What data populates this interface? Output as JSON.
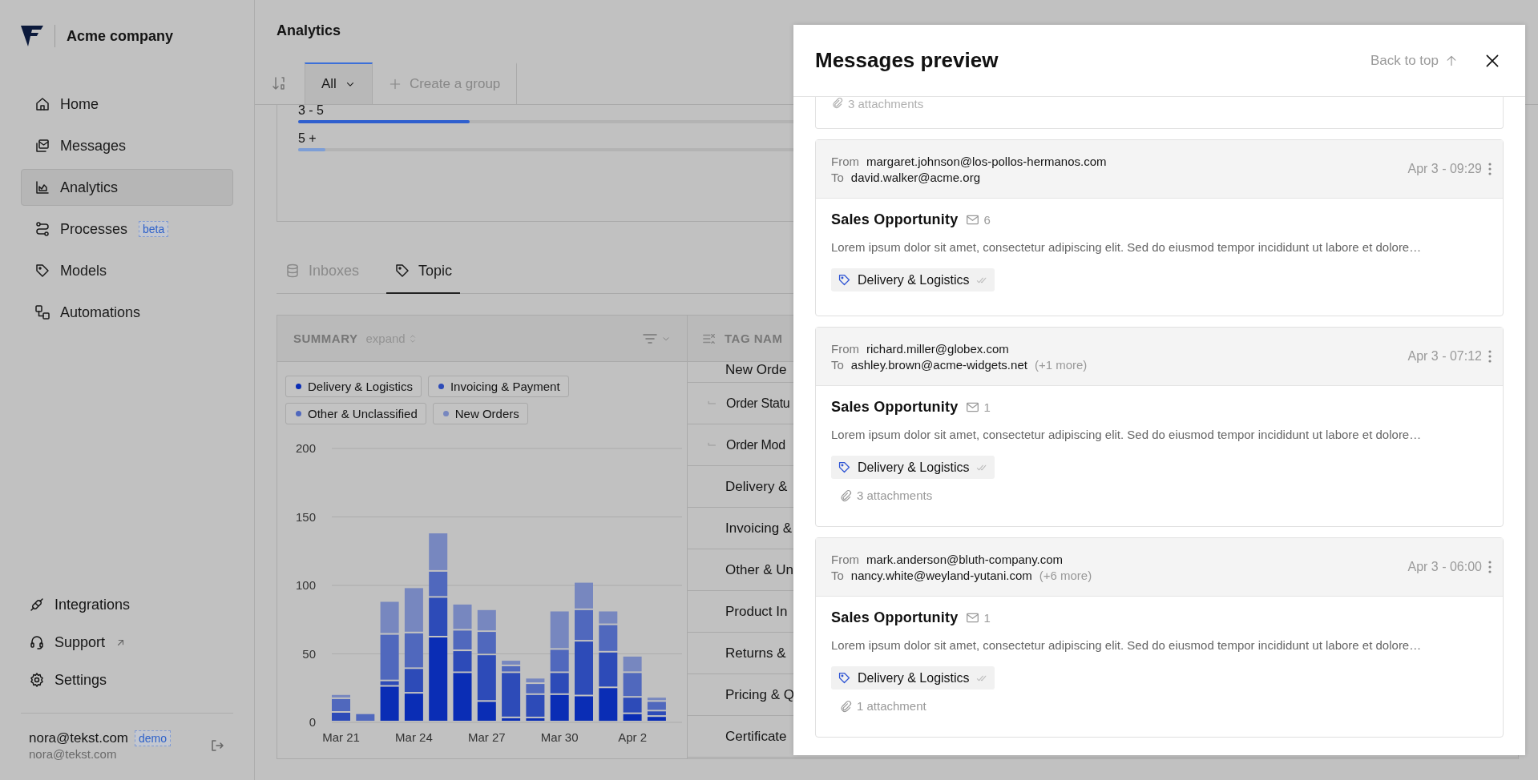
{
  "sidebar": {
    "company": "Acme company",
    "items": [
      {
        "label": "Home",
        "selected": false
      },
      {
        "label": "Messages",
        "selected": false
      },
      {
        "label": "Analytics",
        "selected": true
      },
      {
        "label": "Processes",
        "selected": false,
        "badge": "beta"
      },
      {
        "label": "Models",
        "selected": false
      },
      {
        "label": "Automations",
        "selected": false
      }
    ],
    "footer_items": [
      {
        "label": "Integrations",
        "external": false
      },
      {
        "label": "Support",
        "external": true
      },
      {
        "label": "Settings",
        "external": false
      }
    ],
    "user": {
      "name": "nora@tekst.com",
      "badge": "demo",
      "email": "nora@tekst.com"
    }
  },
  "page": {
    "title": "Analytics"
  },
  "group_tabs": [
    {
      "label": "All",
      "kind": "dropdown",
      "selected": true
    },
    {
      "label": "Create a group",
      "kind": "add",
      "selected": false
    }
  ],
  "distribution": {
    "rows": [
      {
        "label": "3 - 5",
        "level": 0.143
      },
      {
        "label": "5 +",
        "level": 0.023
      }
    ]
  },
  "view_tabs": [
    {
      "label": "Inboxes",
      "selected": false
    },
    {
      "label": "Topic",
      "selected": true
    }
  ],
  "summary": {
    "title": "SUMMARY",
    "toggle": "expand",
    "chart_data": {
      "type": "bar",
      "stacked": true,
      "grid": true,
      "ylim": [
        0,
        200
      ],
      "yticks": [
        0,
        50,
        100,
        150,
        200
      ],
      "categories": [
        "Mar 21",
        null,
        null,
        "Mar 24",
        null,
        null,
        "Mar 27",
        null,
        null,
        "Mar 30",
        null,
        null,
        "Apr 2",
        null
      ],
      "series": [
        {
          "name": "Delivery & Logistics",
          "color": "#0a2db5",
          "values": [
            0,
            0,
            26,
            21,
            62,
            36,
            15,
            3,
            3,
            20,
            19,
            25,
            6,
            4
          ]
        },
        {
          "name": "Invoicing & Payment",
          "color": "#2d4bb8",
          "values": [
            7,
            0,
            4,
            18,
            29,
            16,
            34,
            33,
            17,
            16,
            40,
            26,
            12,
            4
          ]
        },
        {
          "name": "Other & Unclassified",
          "color": "#5068bd",
          "values": [
            10,
            6,
            34,
            26,
            19,
            15,
            17,
            5,
            8,
            17,
            23,
            20,
            18,
            7
          ]
        },
        {
          "name": "New Orders",
          "color": "#7787bf",
          "values": [
            3,
            0,
            24,
            33,
            28,
            19,
            16,
            4,
            4,
            28,
            20,
            10,
            12,
            3
          ]
        }
      ]
    }
  },
  "tag_table": {
    "column": "TAG NAM",
    "rows": [
      {
        "name": "New Orde",
        "children": [
          {
            "name": "Order Statu"
          },
          {
            "name": "Order Mod"
          }
        ]
      },
      {
        "name": "Delivery &"
      },
      {
        "name": "Invoicing &"
      },
      {
        "name": "Other & Un"
      },
      {
        "name": "Product In"
      },
      {
        "name": "Returns &"
      },
      {
        "name": "Pricing & Q"
      },
      {
        "name": "Certificate"
      }
    ]
  },
  "preview": {
    "title": "Messages preview",
    "back_to_top": "Back to top",
    "faded_attachments": "3 attachments",
    "messages": [
      {
        "from_label": "From",
        "from": "margaret.johnson@los-pollos-hermanos.com",
        "to_label": "To",
        "to": "david.walker@acme.org",
        "date": "Apr 3 - 09:29",
        "subject": "Sales Opportunity",
        "count": "6",
        "snippet": "Lorem ipsum dolor sit amet, consectetur adipiscing elit. Sed do eiusmod tempor incididunt ut labore et dolore…",
        "tag": "Delivery & Logistics"
      },
      {
        "from_label": "From",
        "from": "richard.miller@globex.com",
        "to_label": "To",
        "to": "ashley.brown@acme-widgets.net",
        "more": "(+1 more)",
        "date": "Apr 3 - 07:12",
        "subject": "Sales Opportunity",
        "count": "1",
        "snippet": "Lorem ipsum dolor sit amet, consectetur adipiscing elit. Sed do eiusmod tempor incididunt ut labore et dolore…",
        "tag": "Delivery & Logistics",
        "attachments": "3 attachments"
      },
      {
        "from_label": "From",
        "from": "mark.anderson@bluth-company.com",
        "to_label": "To",
        "to": "nancy.white@weyland-yutani.com",
        "more": "(+6 more)",
        "date": "Apr 3 - 06:00",
        "subject": "Sales Opportunity",
        "count": "1",
        "snippet": "Lorem ipsum dolor sit amet, consectetur adipiscing elit. Sed do eiusmod tempor incididunt ut labore et dolore…",
        "tag": "Delivery & Logistics",
        "attachments": "1 attachment"
      }
    ]
  }
}
